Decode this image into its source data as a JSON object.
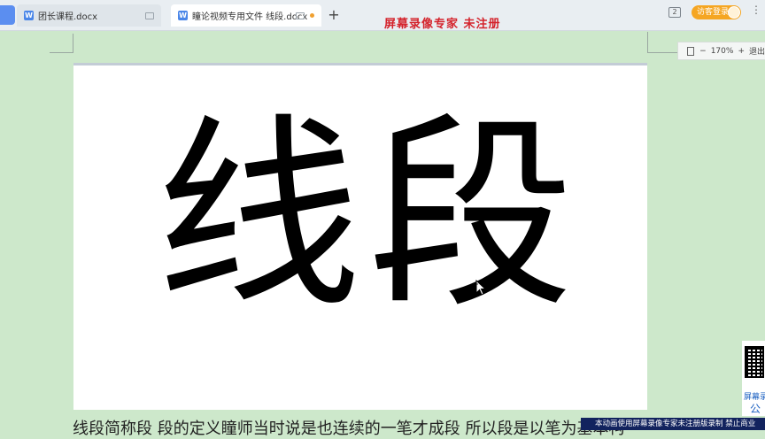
{
  "tabs": [
    {
      "label": "团长课程.docx",
      "icon": "doc-icon"
    },
    {
      "label": "瞳论视频专用文件 线段.docx",
      "icon": "doc-icon"
    }
  ],
  "toolbar": {
    "new_tab": "+",
    "window_count": "2",
    "visitor_login": "访客登录",
    "more": "⋮"
  },
  "watermark": {
    "title": "屏幕录像专家  未注册"
  },
  "zoom": {
    "minus": "−",
    "value": "170%",
    "plus": "+",
    "exit": "退出"
  },
  "document": {
    "heading": "线段",
    "body_line": "线段简称段 段的定义瞳师当时说是也连续的一笔才成段 所以段是以笔为基本构"
  },
  "qr": {
    "label": "屏幕录",
    "label2": "公"
  },
  "banner": {
    "text": "本动画使用屏幕录像专家未注册版录制  禁止商业"
  },
  "colors": {
    "background": "#cde8cb",
    "accent": "#4a86e8",
    "watermark": "#d4232c",
    "login_button": "#f5a623"
  }
}
